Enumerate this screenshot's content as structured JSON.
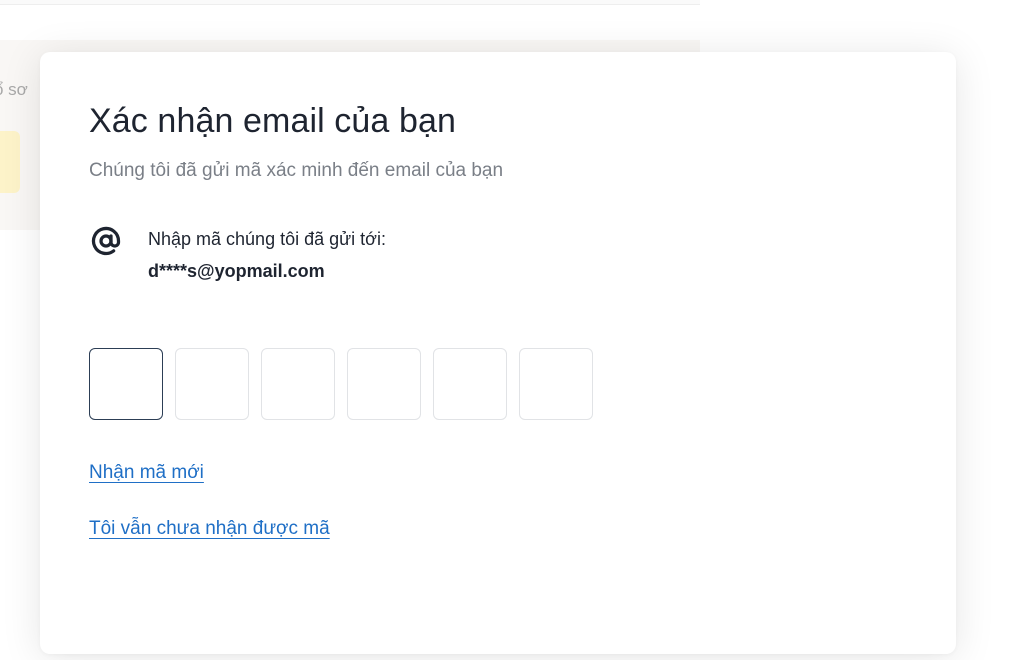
{
  "background": {
    "partial_text": "ổ sơ"
  },
  "modal": {
    "title": "Xác nhận email của bạn",
    "subtitle": "Chúng tôi đã gửi mã xác minh đến email của bạn",
    "sent_to_label": "Nhập mã chúng tôi đã gửi tới:",
    "email": "d****s@yopmail.com",
    "at_icon": "at-sign-icon",
    "code_digits": [
      "",
      "",
      "",
      "",
      "",
      ""
    ],
    "links": {
      "resend": "Nhận mã mới",
      "not_received": "Tôi vẫn chưa nhận được mã"
    }
  },
  "colors": {
    "link": "#1f6fc6",
    "title": "#1e2430",
    "muted": "#7a7f87",
    "focus_border": "#2c3e55",
    "box_border": "#e1e3e6",
    "highlight": "#fdf3c9"
  }
}
